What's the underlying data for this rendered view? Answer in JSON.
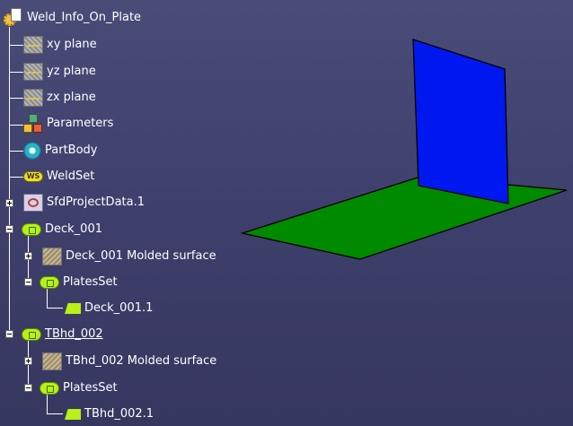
{
  "tree": {
    "root": {
      "label": "Weld_Info_On_Plate",
      "icon": "part-document-icon"
    },
    "nodes": [
      {
        "label": "xy plane",
        "icon": "plane-icon"
      },
      {
        "label": "yz plane",
        "icon": "plane-icon"
      },
      {
        "label": "zx plane",
        "icon": "plane-icon"
      },
      {
        "label": "Parameters",
        "icon": "parameters-icon"
      },
      {
        "label": "PartBody",
        "icon": "partbody-icon"
      },
      {
        "label": "WeldSet",
        "icon": "weldset-icon"
      },
      {
        "label": "SfdProjectData.1",
        "icon": "project-data-icon"
      },
      {
        "label": "Deck_001",
        "icon": "set-icon"
      },
      {
        "label": "Deck_001 Molded surface",
        "icon": "molded-surface-icon"
      },
      {
        "label": "PlatesSet",
        "icon": "set-icon"
      },
      {
        "label": "Deck_001.1",
        "icon": "plate-icon"
      },
      {
        "label": "TBhd_002",
        "icon": "set-icon"
      },
      {
        "label": "TBhd_002 Molded surface",
        "icon": "molded-surface-icon"
      },
      {
        "label": "PlatesSet",
        "icon": "set-icon"
      },
      {
        "label": "TBhd_002.1",
        "icon": "plate-icon"
      }
    ]
  },
  "viewport": {
    "plate_color": "#0018f0",
    "deck_color": "#008a00",
    "background": "#42436e"
  }
}
